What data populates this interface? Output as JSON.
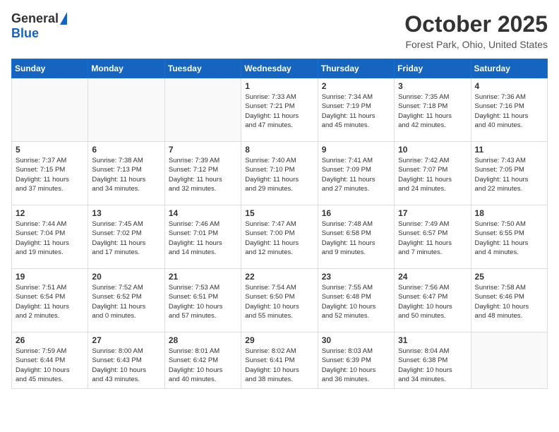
{
  "header": {
    "logo_general": "General",
    "logo_blue": "Blue",
    "month_title": "October 2025",
    "location": "Forest Park, Ohio, United States"
  },
  "days_of_week": [
    "Sunday",
    "Monday",
    "Tuesday",
    "Wednesday",
    "Thursday",
    "Friday",
    "Saturday"
  ],
  "weeks": [
    [
      {
        "day": "",
        "info": ""
      },
      {
        "day": "",
        "info": ""
      },
      {
        "day": "",
        "info": ""
      },
      {
        "day": "1",
        "info": "Sunrise: 7:33 AM\nSunset: 7:21 PM\nDaylight: 11 hours\nand 47 minutes."
      },
      {
        "day": "2",
        "info": "Sunrise: 7:34 AM\nSunset: 7:19 PM\nDaylight: 11 hours\nand 45 minutes."
      },
      {
        "day": "3",
        "info": "Sunrise: 7:35 AM\nSunset: 7:18 PM\nDaylight: 11 hours\nand 42 minutes."
      },
      {
        "day": "4",
        "info": "Sunrise: 7:36 AM\nSunset: 7:16 PM\nDaylight: 11 hours\nand 40 minutes."
      }
    ],
    [
      {
        "day": "5",
        "info": "Sunrise: 7:37 AM\nSunset: 7:15 PM\nDaylight: 11 hours\nand 37 minutes."
      },
      {
        "day": "6",
        "info": "Sunrise: 7:38 AM\nSunset: 7:13 PM\nDaylight: 11 hours\nand 34 minutes."
      },
      {
        "day": "7",
        "info": "Sunrise: 7:39 AM\nSunset: 7:12 PM\nDaylight: 11 hours\nand 32 minutes."
      },
      {
        "day": "8",
        "info": "Sunrise: 7:40 AM\nSunset: 7:10 PM\nDaylight: 11 hours\nand 29 minutes."
      },
      {
        "day": "9",
        "info": "Sunrise: 7:41 AM\nSunset: 7:09 PM\nDaylight: 11 hours\nand 27 minutes."
      },
      {
        "day": "10",
        "info": "Sunrise: 7:42 AM\nSunset: 7:07 PM\nDaylight: 11 hours\nand 24 minutes."
      },
      {
        "day": "11",
        "info": "Sunrise: 7:43 AM\nSunset: 7:05 PM\nDaylight: 11 hours\nand 22 minutes."
      }
    ],
    [
      {
        "day": "12",
        "info": "Sunrise: 7:44 AM\nSunset: 7:04 PM\nDaylight: 11 hours\nand 19 minutes."
      },
      {
        "day": "13",
        "info": "Sunrise: 7:45 AM\nSunset: 7:02 PM\nDaylight: 11 hours\nand 17 minutes."
      },
      {
        "day": "14",
        "info": "Sunrise: 7:46 AM\nSunset: 7:01 PM\nDaylight: 11 hours\nand 14 minutes."
      },
      {
        "day": "15",
        "info": "Sunrise: 7:47 AM\nSunset: 7:00 PM\nDaylight: 11 hours\nand 12 minutes."
      },
      {
        "day": "16",
        "info": "Sunrise: 7:48 AM\nSunset: 6:58 PM\nDaylight: 11 hours\nand 9 minutes."
      },
      {
        "day": "17",
        "info": "Sunrise: 7:49 AM\nSunset: 6:57 PM\nDaylight: 11 hours\nand 7 minutes."
      },
      {
        "day": "18",
        "info": "Sunrise: 7:50 AM\nSunset: 6:55 PM\nDaylight: 11 hours\nand 4 minutes."
      }
    ],
    [
      {
        "day": "19",
        "info": "Sunrise: 7:51 AM\nSunset: 6:54 PM\nDaylight: 11 hours\nand 2 minutes."
      },
      {
        "day": "20",
        "info": "Sunrise: 7:52 AM\nSunset: 6:52 PM\nDaylight: 11 hours\nand 0 minutes."
      },
      {
        "day": "21",
        "info": "Sunrise: 7:53 AM\nSunset: 6:51 PM\nDaylight: 10 hours\nand 57 minutes."
      },
      {
        "day": "22",
        "info": "Sunrise: 7:54 AM\nSunset: 6:50 PM\nDaylight: 10 hours\nand 55 minutes."
      },
      {
        "day": "23",
        "info": "Sunrise: 7:55 AM\nSunset: 6:48 PM\nDaylight: 10 hours\nand 52 minutes."
      },
      {
        "day": "24",
        "info": "Sunrise: 7:56 AM\nSunset: 6:47 PM\nDaylight: 10 hours\nand 50 minutes."
      },
      {
        "day": "25",
        "info": "Sunrise: 7:58 AM\nSunset: 6:46 PM\nDaylight: 10 hours\nand 48 minutes."
      }
    ],
    [
      {
        "day": "26",
        "info": "Sunrise: 7:59 AM\nSunset: 6:44 PM\nDaylight: 10 hours\nand 45 minutes."
      },
      {
        "day": "27",
        "info": "Sunrise: 8:00 AM\nSunset: 6:43 PM\nDaylight: 10 hours\nand 43 minutes."
      },
      {
        "day": "28",
        "info": "Sunrise: 8:01 AM\nSunset: 6:42 PM\nDaylight: 10 hours\nand 40 minutes."
      },
      {
        "day": "29",
        "info": "Sunrise: 8:02 AM\nSunset: 6:41 PM\nDaylight: 10 hours\nand 38 minutes."
      },
      {
        "day": "30",
        "info": "Sunrise: 8:03 AM\nSunset: 6:39 PM\nDaylight: 10 hours\nand 36 minutes."
      },
      {
        "day": "31",
        "info": "Sunrise: 8:04 AM\nSunset: 6:38 PM\nDaylight: 10 hours\nand 34 minutes."
      },
      {
        "day": "",
        "info": ""
      }
    ]
  ]
}
